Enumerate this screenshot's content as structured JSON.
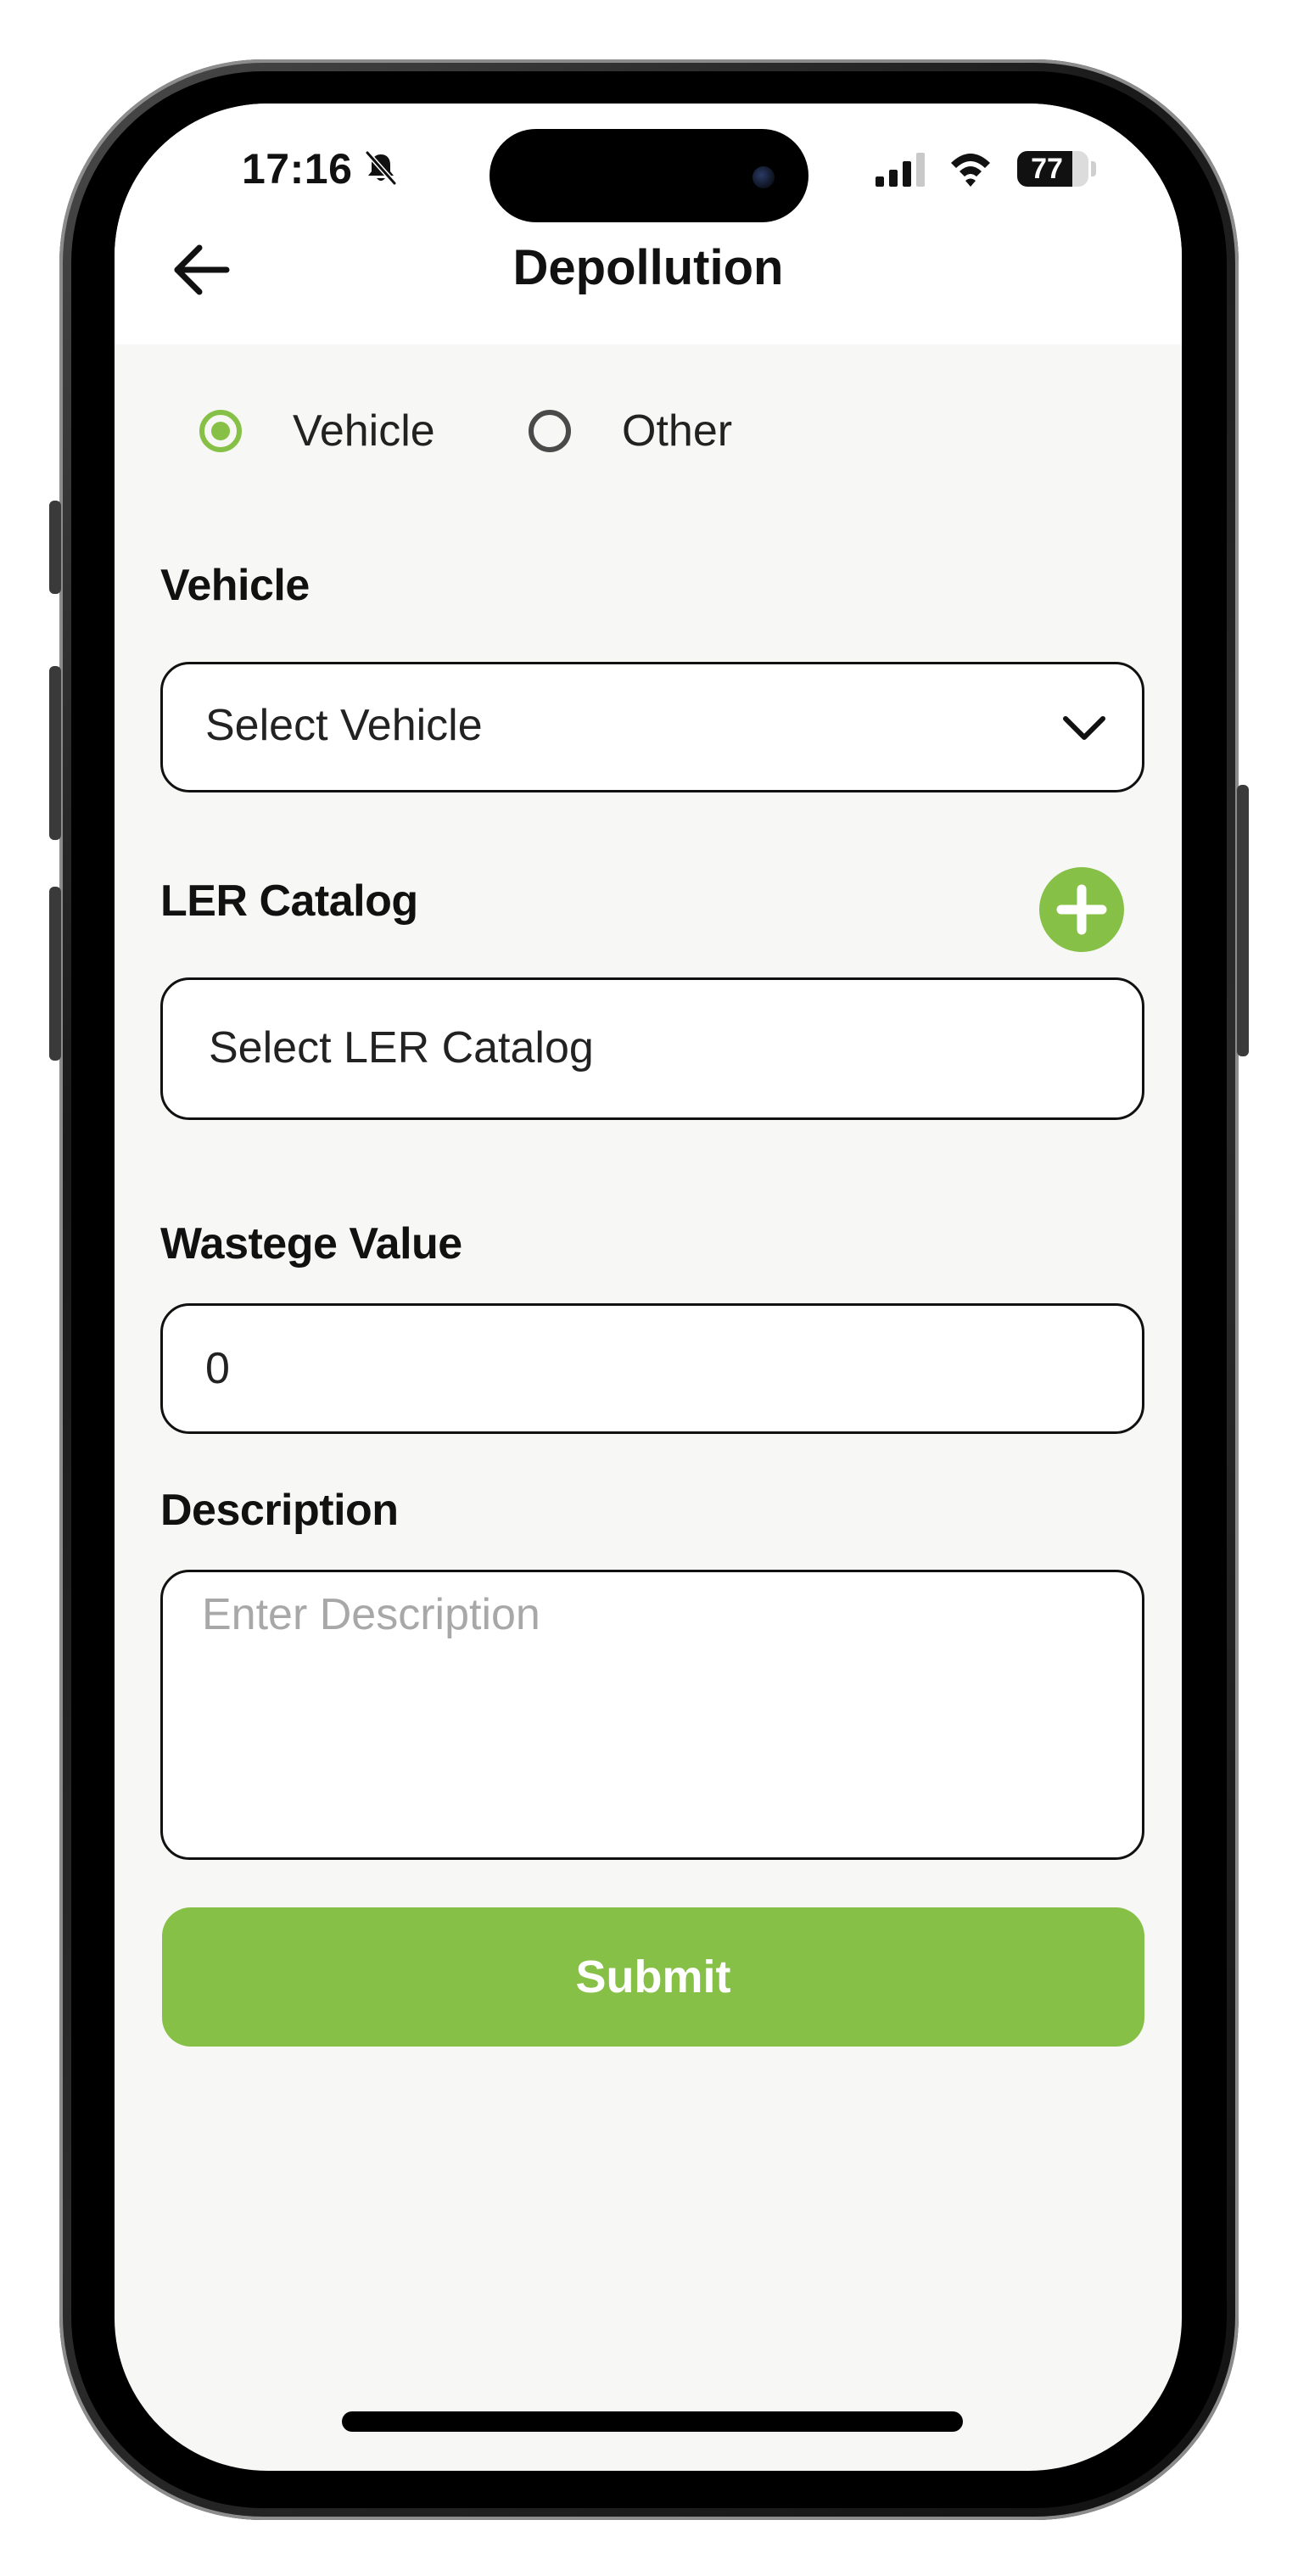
{
  "status_bar": {
    "time": "17:16",
    "battery": "77",
    "battery_level": 0.77
  },
  "header": {
    "title": "Depollution"
  },
  "type_selector": {
    "options": [
      {
        "label": "Vehicle",
        "selected": true
      },
      {
        "label": "Other",
        "selected": false
      }
    ]
  },
  "form": {
    "vehicle": {
      "label": "Vehicle",
      "value": "Select Vehicle"
    },
    "ler_catalog": {
      "label": "LER Catalog",
      "value": "Select LER Catalog"
    },
    "wastage": {
      "label": "Wastege Value",
      "value": "0"
    },
    "description": {
      "label": "Description",
      "placeholder": "Enter Description",
      "value": ""
    },
    "submit_label": "Submit"
  },
  "colors": {
    "accent": "#86c046",
    "background": "#f7f7f5",
    "text": "#111111",
    "placeholder": "#a8a8a8"
  },
  "icons": {
    "back": "arrow-left-icon",
    "dropdown": "chevron-down-icon",
    "add": "plus-icon",
    "mute": "bell-slash-icon",
    "signal": "cellular-signal-icon",
    "wifi": "wifi-icon"
  }
}
